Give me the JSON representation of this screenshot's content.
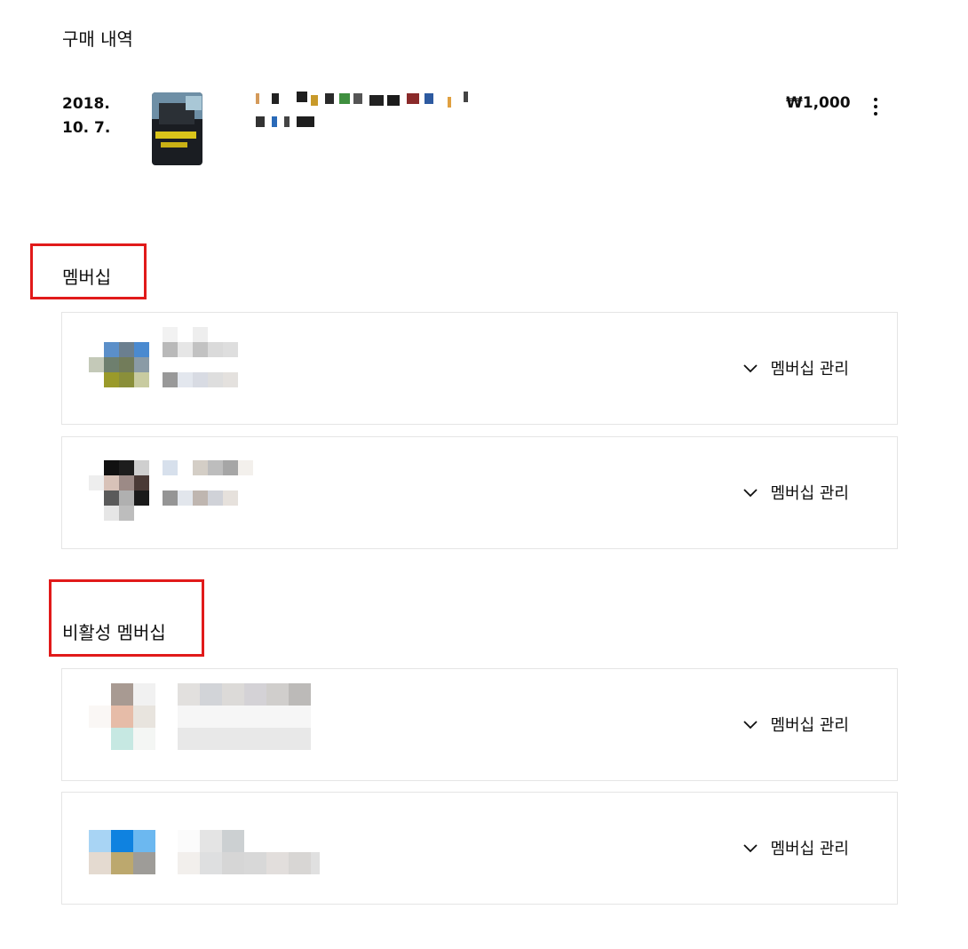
{
  "purchase_history": {
    "title": "구매 내역",
    "item": {
      "date_line1": "2018.",
      "date_line2": "10. 7.",
      "price": "₩1,000"
    }
  },
  "memberships": {
    "title": "멤버십",
    "cards": [
      {
        "action_label": "멤버십 관리",
        "icon": "chevron-down-icon"
      },
      {
        "action_label": "멤버십 관리",
        "icon": "chevron-down-icon"
      }
    ]
  },
  "inactive_memberships": {
    "title": "비활성 멤버십",
    "cards": [
      {
        "action_label": "멤버십 관리",
        "icon": "chevron-down-icon"
      },
      {
        "action_label": "멤버십 관리",
        "icon": "chevron-down-icon"
      }
    ]
  },
  "colors": {
    "highlight": "#e11a1a",
    "card_border": "#e5e5e5",
    "text": "#0f0f0f"
  }
}
